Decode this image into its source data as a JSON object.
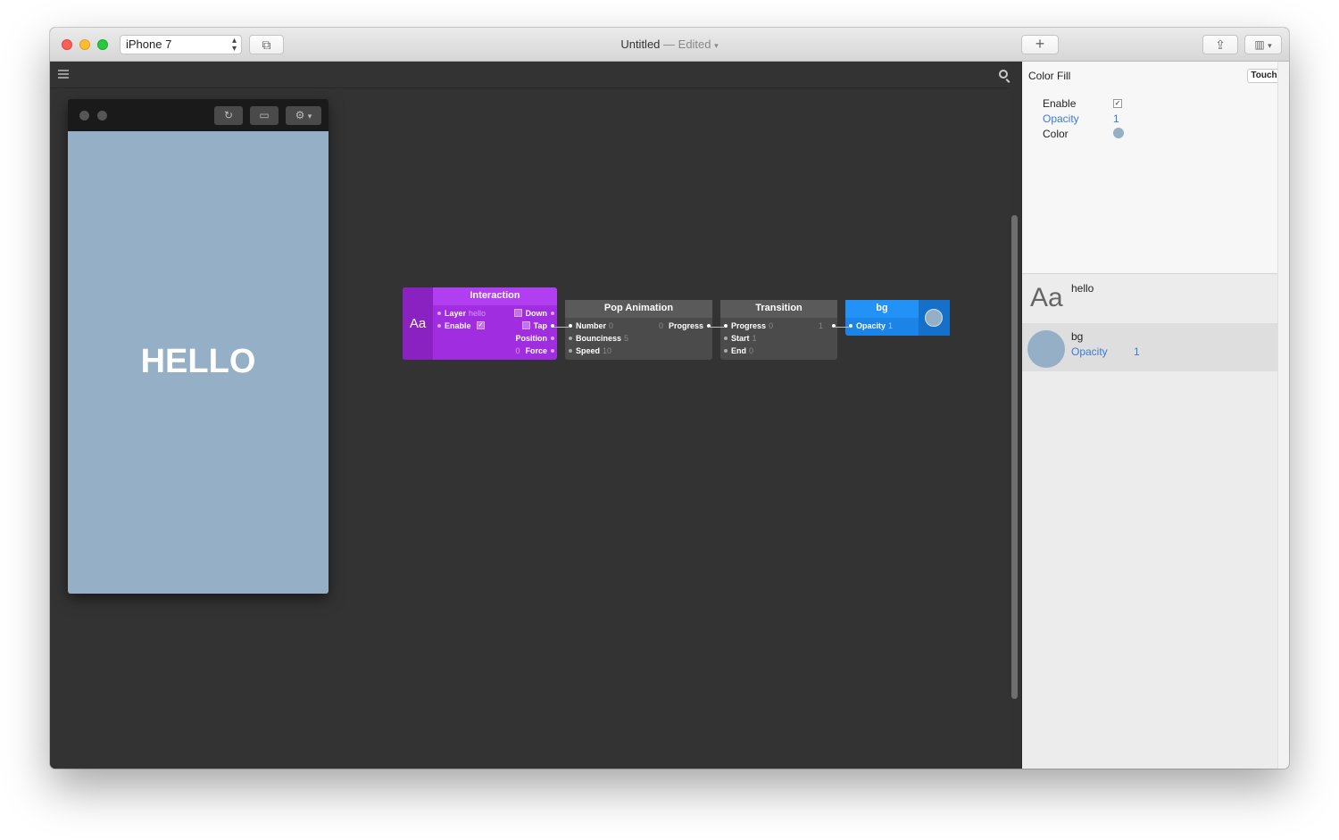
{
  "toolbar": {
    "device": "iPhone 7",
    "title": "Untitled",
    "edited": "— Edited",
    "add_label": "+"
  },
  "preview": {
    "text": "HELLO",
    "background_color": "#95afc7"
  },
  "patches": {
    "interaction": {
      "title": "Interaction",
      "badge": "Aa",
      "inputs": [
        {
          "label": "Layer",
          "value": "hello"
        },
        {
          "label": "Enable",
          "value": "✓"
        }
      ],
      "outputs": [
        "Down",
        "Tap",
        "Position",
        "Force"
      ],
      "force_value": "0"
    },
    "pop_animation": {
      "title": "Pop Animation",
      "inputs": [
        {
          "label": "Number",
          "value": "0"
        },
        {
          "label": "Bounciness",
          "value": "5"
        },
        {
          "label": "Speed",
          "value": "10"
        }
      ],
      "output": {
        "label": "Progress",
        "value": "0"
      }
    },
    "transition": {
      "title": "Transition",
      "inputs": [
        {
          "label": "Progress",
          "value": "0"
        },
        {
          "label": "Start",
          "value": "1"
        },
        {
          "label": "End",
          "value": "0"
        }
      ],
      "output_value": "1"
    },
    "bg": {
      "title": "bg",
      "inputs": [
        {
          "label": "Opacity",
          "value": "1"
        }
      ],
      "color": "#95afc7"
    }
  },
  "inspector": {
    "title": "Color Fill",
    "touch_label": "Touch",
    "rows": [
      {
        "label": "Enable",
        "value": "✓"
      },
      {
        "label": "Opacity",
        "value": "1"
      },
      {
        "label": "Color"
      }
    ],
    "layers": [
      {
        "badge": "Aa",
        "name": "hello"
      },
      {
        "name": "bg",
        "prop": "Opacity",
        "prop_value": "1"
      }
    ]
  },
  "colors": {
    "interaction": "#a02ee0",
    "layer_blue": "#1c84e6",
    "canvas": "#333333",
    "link": "#3a7bd5"
  }
}
